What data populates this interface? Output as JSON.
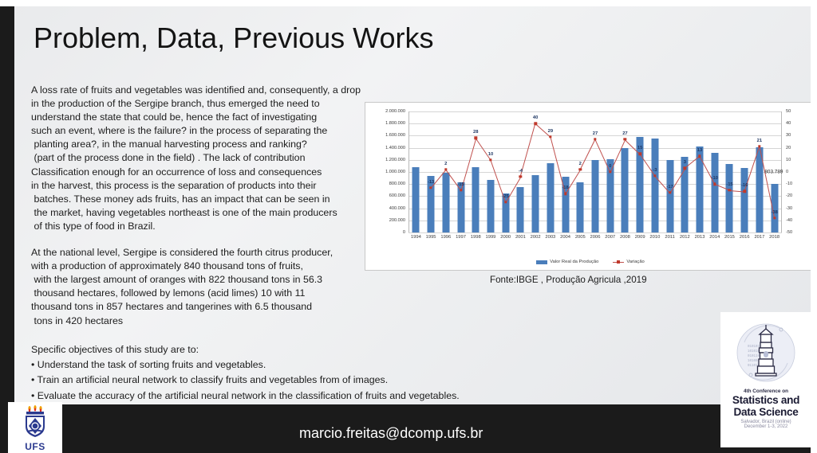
{
  "slide": {
    "title": "Problem, Data, Previous Works",
    "email": "marcio.freitas@dcomp.ufs.br"
  },
  "body": {
    "paragraphs": [
      [
        "A loss rate of fruits and vegetables was identified and, consequently, a drop",
        "in the production of the Sergipe branch, thus emerged the need to",
        "understand the state that could be, hence the fact of investigating",
        "such an event, where is the failure? in the process of separating the",
        " planting area?, in the manual harvesting process and ranking?",
        " (part of the process done in the field) . The lack of contribution",
        "Classification enough for an occurrence of loss and consequences",
        "in the harvest, this process is the separation of products into their",
        " batches. These money ads fruits, has an impact that can be seen in",
        " the market, having vegetables northeast is one of the main producers",
        " of this type of food in Brazil."
      ],
      [
        "At the national level, Sergipe is considered the fourth citrus producer,",
        "with a production of approximately 840 thousand tons of fruits,",
        " with the largest amount of oranges with 822 thousand tons in 56.3",
        " thousand hectares, followed by lemons (acid limes) 10 with 11",
        "thousand tons in 857 hectares and tangerines with 6.5 thousand",
        " tons in 420 hectares"
      ]
    ],
    "objectives": [
      "Specific objectives of this study are to:",
      "• Understand the task of sorting fruits and vegetables.",
      "• Train an artificial neural network to classify fruits and vegetables from of images.",
      "• Evaluate the accuracy of the artificial neural network in the classification of fruits and vegetables."
    ]
  },
  "chart_caption": "Fonte:IBGE , Produção Agricula ,2019",
  "conference_logo": {
    "line1": "4th Conference on",
    "line2a": "Statistics and",
    "line2b": "Data Science",
    "line3": "Salvador, Brazil (online)",
    "line4": "December 1-3, 2022"
  },
  "ufs_logo": {
    "label": "UFS"
  },
  "chart_data": {
    "type": "bar",
    "title": "",
    "xlabel": "",
    "ylabel": "",
    "grid": true,
    "legend_position": "bottom",
    "categories": [
      "1994",
      "1995",
      "1996",
      "1997",
      "1998",
      "1999",
      "2000",
      "2001",
      "2002",
      "2003",
      "2004",
      "2005",
      "2006",
      "2007",
      "2008",
      "2009",
      "2010",
      "2011",
      "2012",
      "2013",
      "2014",
      "2015",
      "2016",
      "2017",
      "2018"
    ],
    "series": [
      {
        "name": "Valor Real da Produção",
        "type": "bar",
        "axis": "left",
        "color": "#4a7ebb",
        "values": [
          1080000,
          940000,
          985000,
          830000,
          1085000,
          870000,
          640000,
          755000,
          950000,
          1150000,
          925000,
          835000,
          1200000,
          1205000,
          1395000,
          1580000,
          1555000,
          1200000,
          1255000,
          1420000,
          1310000,
          1135000,
          1065000,
          1403789,
          803789
        ]
      },
      {
        "name": "Variação",
        "type": "line",
        "axis": "right",
        "color": "#c0504d",
        "values": [
          null,
          -13,
          2,
          -15,
          28,
          10,
          -25,
          -4,
          40,
          29,
          -18,
          2,
          27,
          0,
          27,
          15,
          -3,
          -17,
          3,
          13,
          -10,
          -15,
          -16,
          21,
          -38
        ],
        "labels": [
          "",
          "-13",
          "2",
          "-15",
          "28",
          "10",
          "-25",
          "-4",
          "40",
          "29",
          "-18",
          "2",
          "27",
          "0",
          "27",
          "15",
          "-3",
          "-17",
          "3",
          "13",
          "-10",
          "-15",
          "-16",
          "21",
          "-38"
        ]
      }
    ],
    "y_left_ticks": [
      "0",
      "200.000",
      "400.000",
      "600.000",
      "800.000",
      "1.000.000",
      "1.200.000",
      "1.400.000",
      "1.600.000",
      "1.800.000",
      "2.000.000"
    ],
    "y_left_lim": [
      0,
      2000000
    ],
    "y_right_ticks": [
      "-50",
      "-40",
      "-30",
      "-20",
      "-10",
      "0",
      "10",
      "20",
      "30",
      "40",
      "50"
    ],
    "y_right_lim": [
      -50,
      50
    ],
    "annotations": [
      {
        "text": "803.789",
        "category": "2017"
      }
    ]
  }
}
